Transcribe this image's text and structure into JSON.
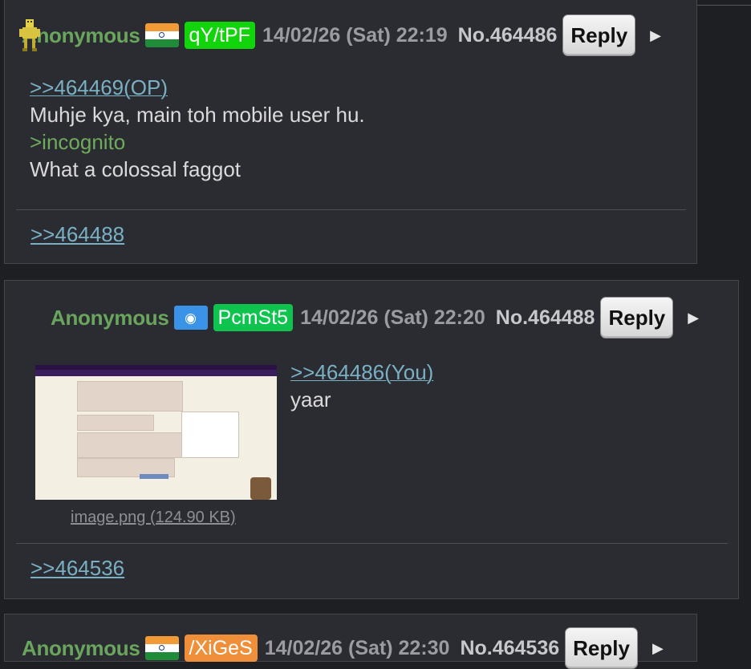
{
  "posts": [
    {
      "name": "Anonymous",
      "flag_icon": "india-flag-icon",
      "poster_id": "qY/tPF",
      "datetime": "14/02/26 (Sat) 22:19",
      "number": "No.464486",
      "reply_label": "Reply",
      "body": {
        "quote": ">>464469(OP)",
        "line1": "Muhje kya, main toh mobile user hu.",
        "greentext": ">incognito",
        "line2": "What a colossal faggot"
      },
      "backlinks": [
        ">>464488"
      ]
    },
    {
      "name": "Anonymous",
      "flag_icon": "united-nations-flag-icon",
      "poster_id": "PcmSt5",
      "datetime": "14/02/26 (Sat) 22:20",
      "number": "No.464488",
      "reply_label": "Reply",
      "body": {
        "quote": ">>464486(You)",
        "line1": "yaar"
      },
      "file": {
        "label": "image.png (124.90 KB)"
      },
      "backlinks": [
        ">>464536"
      ]
    },
    {
      "name": "Anonymous",
      "flag_icon": "india-flag-icon",
      "poster_id": "/XiGeS",
      "datetime": "14/02/26 (Sat) 22:30",
      "number": "No.464536",
      "reply_label": "Reply"
    }
  ],
  "icons": {
    "expand": "triangle-right-icon",
    "avatar": "pixel-figure-icon"
  },
  "colors": {
    "name": "#6aa55d",
    "link": "#7ab0c4",
    "post_bg": "#2b2c31",
    "page_bg": "#1e1f23"
  }
}
